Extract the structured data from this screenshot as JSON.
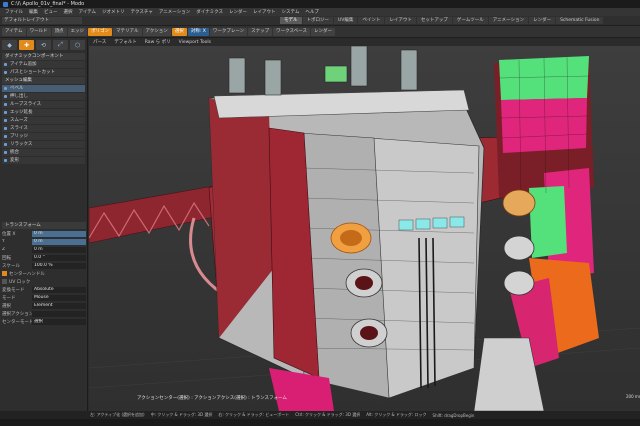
{
  "window": {
    "title": "C:\\i\\ Apollo_01v_final* - Modo"
  },
  "menu": [
    "ファイル",
    "編集",
    "ビュー",
    "選択",
    "アイテム",
    "ジオメトリ",
    "テクスチャ",
    "アニメーション",
    "ダイナミクス",
    "レンダー",
    "レイアウト",
    "システム",
    "ヘルプ"
  ],
  "layout_select": "デフォルトレイアウト",
  "layout_tabs": [
    {
      "label": "モデル",
      "active": true
    },
    {
      "label": "トポロジー",
      "active": false
    },
    {
      "label": "UV編集",
      "active": false
    },
    {
      "label": "ペイント",
      "active": false
    },
    {
      "label": "レイアウト",
      "active": false
    },
    {
      "label": "セットアップ",
      "active": false
    },
    {
      "label": "ゲームツール",
      "active": false
    },
    {
      "label": "アニメーション",
      "active": false
    },
    {
      "label": "レンダー",
      "active": false
    },
    {
      "label": "Schematic Fusion",
      "active": false
    }
  ],
  "toolbar": {
    "items": [
      {
        "label": "アイテム",
        "style": "plain"
      },
      {
        "label": "ワールド",
        "style": "plain"
      },
      {
        "label": "頂点",
        "style": "plain"
      },
      {
        "label": "エッジ",
        "style": "plain"
      },
      {
        "label": "ポリゴン",
        "style": "orange"
      },
      {
        "label": "マテリアル",
        "style": "plain"
      },
      {
        "label": "アクション",
        "style": "plain"
      },
      {
        "label": "選択",
        "style": "orange"
      },
      {
        "label": "対称: X",
        "style": "blue"
      },
      {
        "label": "ワークプレーン",
        "style": "plain"
      },
      {
        "label": "スナップ",
        "style": "plain"
      },
      {
        "label": "ワークスペース",
        "style": "plain"
      },
      {
        "label": "レンダー",
        "style": "plain"
      }
    ]
  },
  "left_panel": {
    "tool_icons": [
      "◆",
      "✚",
      "⟲",
      "⤢",
      "⬡"
    ],
    "sections": [
      {
        "title": "ダイナミックコンポーネント",
        "items": []
      },
      {
        "title": "",
        "items": [
          {
            "label": "アイテム追加",
            "highlight": false
          },
          {
            "label": "パスとショートカット",
            "highlight": false
          }
        ]
      },
      {
        "title": "メッシュ編集",
        "items": [
          {
            "label": "ベベル",
            "highlight": true
          },
          {
            "label": "押し出し",
            "highlight": false
          },
          {
            "label": "ループスライス",
            "highlight": false
          },
          {
            "label": "エッジ延長",
            "highlight": false
          },
          {
            "label": "スムーズ",
            "highlight": false
          },
          {
            "label": "スライス",
            "highlight": false
          },
          {
            "label": "ブリッジ",
            "highlight": false
          },
          {
            "label": "リラックス",
            "highlight": false
          },
          {
            "label": "統合",
            "highlight": false
          },
          {
            "label": "変形",
            "highlight": false
          }
        ]
      }
    ]
  },
  "transform_panel": {
    "title": "トランスフォーム",
    "rows": [
      {
        "label": "位置 X",
        "value": "0 m",
        "highlight": true
      },
      {
        "label": "Y",
        "value": "0 m",
        "highlight": true
      },
      {
        "label": "Z",
        "value": "0 m",
        "highlight": false
      },
      {
        "label": "回転",
        "value": "0.0 °",
        "highlight": false
      },
      {
        "label": "スケール",
        "value": "100.0 %",
        "highlight": false
      }
    ],
    "checks": [
      {
        "label": "センターハンドル",
        "on": true
      },
      {
        "label": "UV ロック",
        "on": false
      }
    ],
    "extras": [
      {
        "label": "変換モード",
        "value": "Absolute"
      },
      {
        "label": "モード",
        "value": "Mouse"
      },
      {
        "label": "選択",
        "value": "Element"
      },
      {
        "label": "選択アクションセンター",
        "value": ""
      },
      {
        "label": "センターモード",
        "value": "選択"
      }
    ]
  },
  "viewport": {
    "header": [
      "パース",
      "デフォルト",
      "Raw  ら ポリ",
      "Viewport Tools"
    ],
    "info": "アクションセンター(選択) : アクションアクシス(選択) : トランスフォーム",
    "right_readout": "200 mm"
  },
  "status": [
    "左: アクティブ化 (選択を追加)",
    "中: クリック & ドラッグ: 3D 選択",
    "右: クリック & ドラッグ: ビューポート",
    "Ctrl: クリック & ドラッグ: 3D 選択",
    "Alt: クリック & ドラッグ: ロック",
    "Shift: dragDropBegin"
  ],
  "colors": {
    "accent": "#e28a1a",
    "highlight_blue": "#4a6f92",
    "model_red": "#b2313a",
    "model_pink": "#e0267c",
    "model_green": "#54e07a",
    "model_orange": "#ec6a1c",
    "model_grey": "#c8c8c8"
  }
}
